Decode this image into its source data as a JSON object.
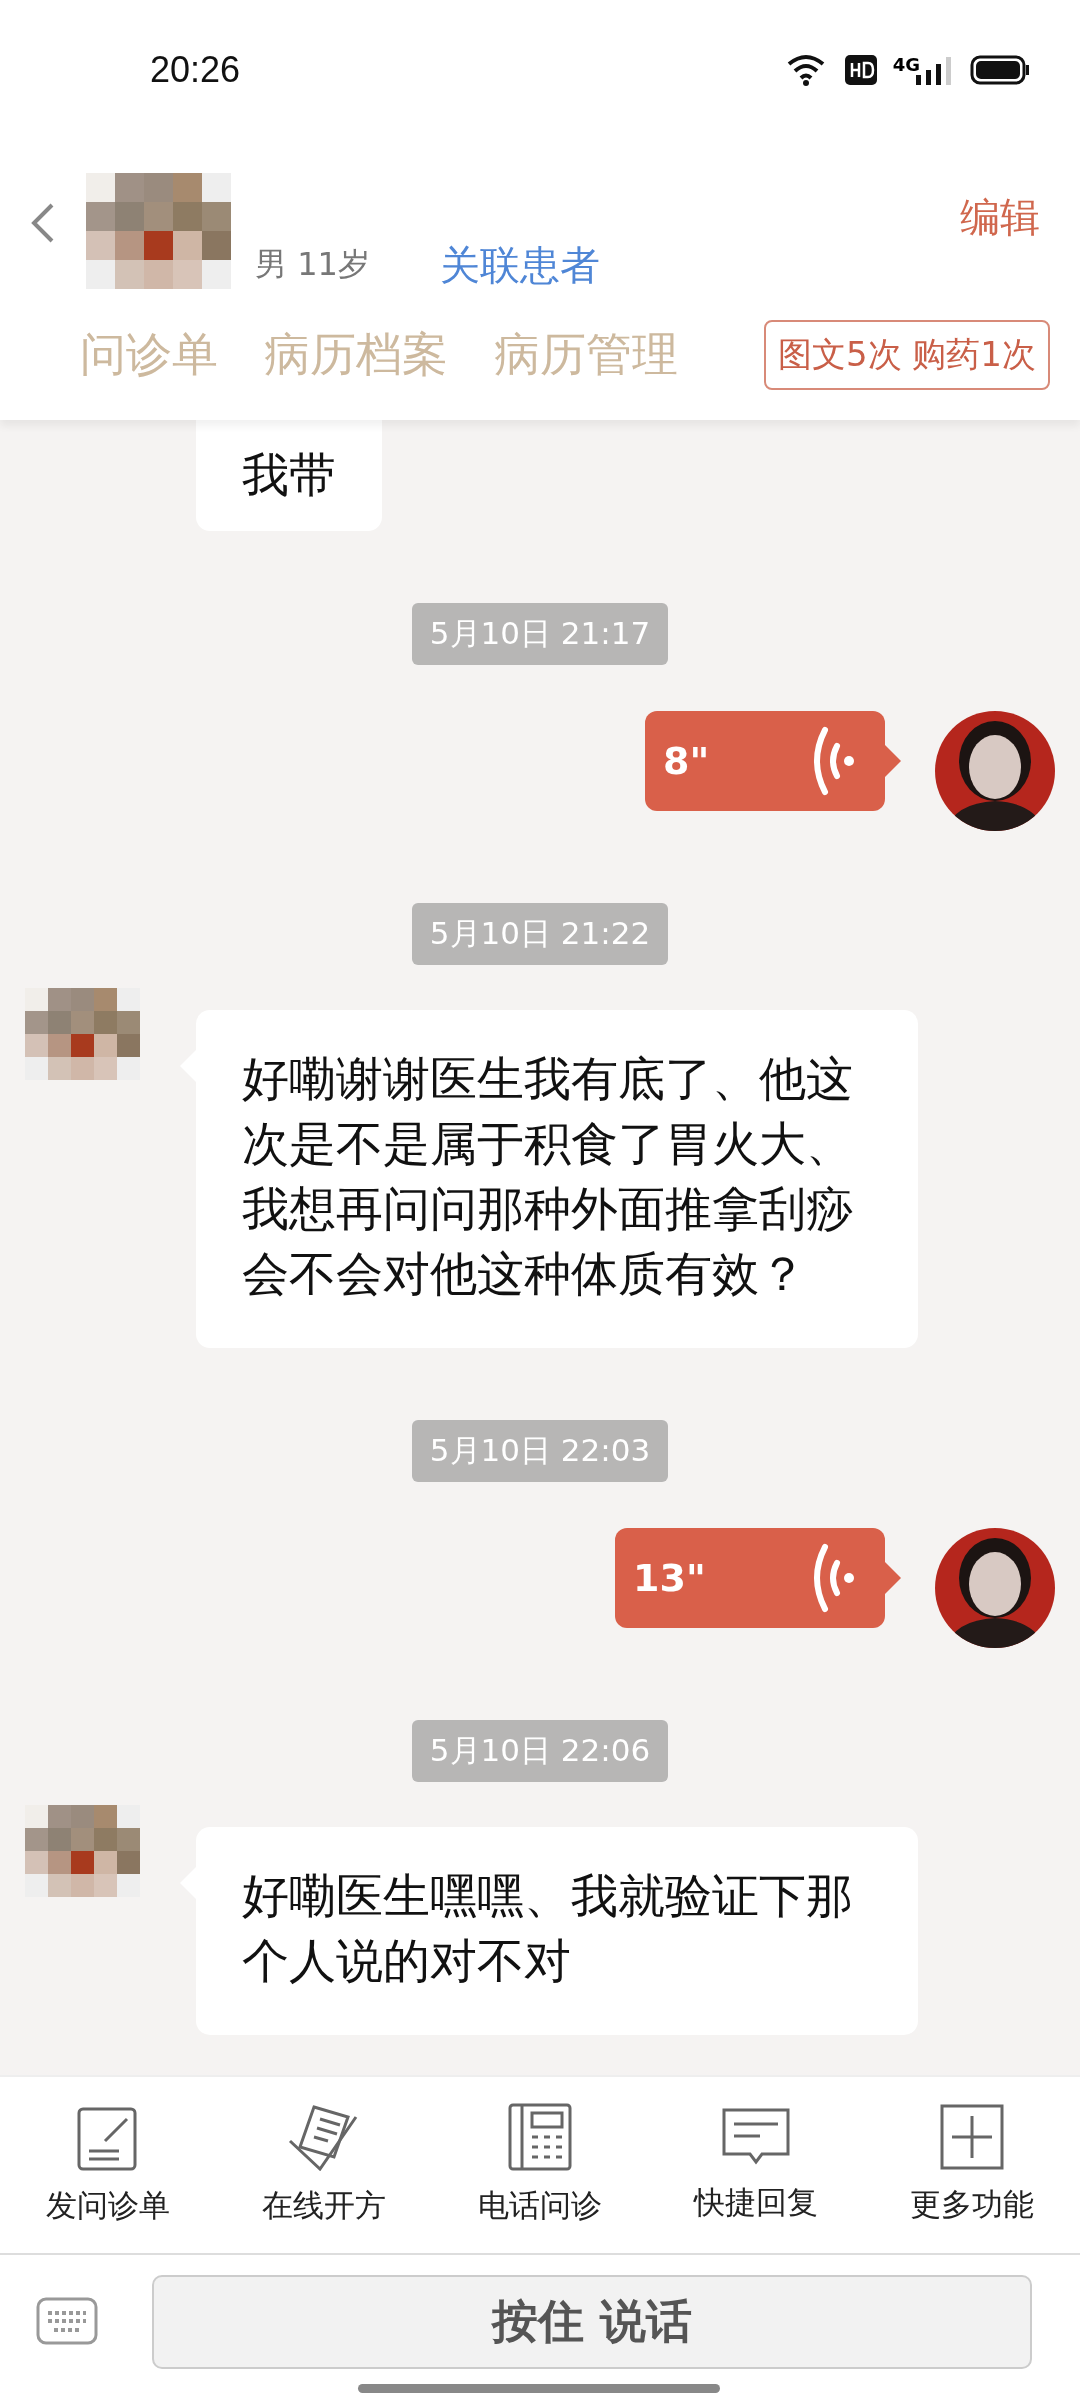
{
  "status_bar": {
    "time": "20:26",
    "network": "4G"
  },
  "header": {
    "patient_info": "男 11岁",
    "link": "关联患者",
    "edit": "编辑",
    "tabs": [
      "问诊单",
      "病历档案",
      "病历管理"
    ],
    "badge": "图文5次 购药1次"
  },
  "messages": [
    {
      "kind": "partial",
      "text": "我带"
    },
    {
      "kind": "time",
      "text": "5月10日 21:17"
    },
    {
      "kind": "voice",
      "duration": "8\""
    },
    {
      "kind": "time",
      "text": "5月10日 21:22"
    },
    {
      "kind": "patient",
      "text": "好嘞谢谢医生我有底了、他这次是不是属于积食了胃火大、我想再问问那种外面推拿刮痧会不会对他这种体质有效？"
    },
    {
      "kind": "time",
      "text": "5月10日 22:03"
    },
    {
      "kind": "voice",
      "duration": "13\""
    },
    {
      "kind": "time",
      "text": "5月10日 22:06"
    },
    {
      "kind": "patient",
      "text": "好嘞医生嘿嘿、我就验证下那个人说的对不对"
    }
  ],
  "toolbar": [
    {
      "kind": "form",
      "label": "发问诊单"
    },
    {
      "kind": "prescription",
      "label": "在线开方"
    },
    {
      "kind": "phone",
      "label": "电话问诊"
    },
    {
      "kind": "reply",
      "label": "快捷回复"
    },
    {
      "kind": "more",
      "label": "更多功能"
    }
  ],
  "input_bar": {
    "hold_button": "按住 说话"
  }
}
